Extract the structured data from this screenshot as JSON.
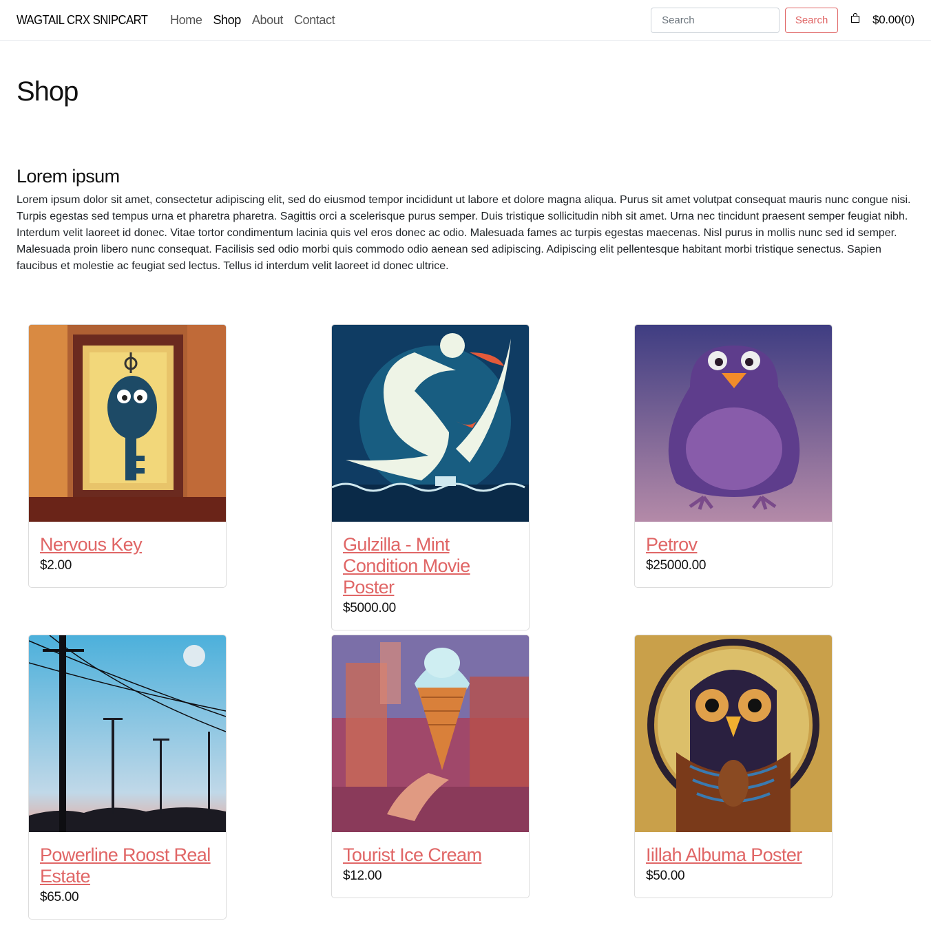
{
  "header": {
    "brand": "WAGTAIL CRX SNIPCART",
    "nav": [
      "Home",
      "Shop",
      "About",
      "Contact"
    ],
    "active_nav": "Shop",
    "search_placeholder": "Search",
    "search_button": "Search",
    "cart_total": "$0.00(0)"
  },
  "page": {
    "title": "Shop",
    "section_title": "Lorem ipsum",
    "intro": "Lorem ipsum dolor sit amet, consectetur adipiscing elit, sed do eiusmod tempor incididunt ut labore et dolore magna aliqua. Purus sit amet volutpat consequat mauris nunc congue nisi. Turpis egestas sed tempus urna et pharetra pharetra. Sagittis orci a scelerisque purus semper. Duis tristique sollicitudin nibh sit amet. Urna nec tincidunt praesent semper feugiat nibh. Interdum velit laoreet id donec. Vitae tortor condimentum lacinia quis vel eros donec ac odio. Malesuada fames ac turpis egestas maecenas. Nisl purus in mollis nunc sed id semper. Malesuada proin libero nunc consequat. Facilisis sed odio morbi quis commodo odio aenean sed adipiscing. Adipiscing elit pellentesque habitant morbi tristique senectus. Sapien faucibus et molestie ac feugiat sed lectus. Tellus id interdum velit laoreet id donec ultrice."
  },
  "products": [
    {
      "name": "Nervous Key",
      "price": "$2.00"
    },
    {
      "name": "Gulzilla - Mint Condition Movie Poster",
      "price": "$5000.00"
    },
    {
      "name": "Petrov",
      "price": "$25000.00"
    },
    {
      "name": "Powerline Roost Real Estate",
      "price": "$65.00"
    },
    {
      "name": "Tourist Ice Cream",
      "price": "$12.00"
    },
    {
      "name": "Iillah Albuma Poster",
      "price": "$50.00"
    }
  ],
  "colors": {
    "accent": "#e06666",
    "text": "#212529"
  }
}
